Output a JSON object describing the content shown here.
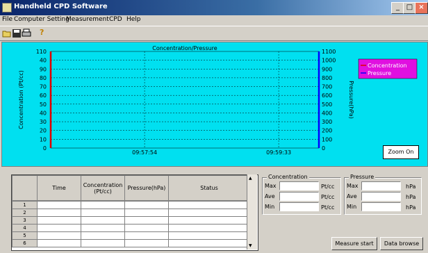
{
  "window": {
    "title": "Handheld CPD Software"
  },
  "menu": [
    "File",
    "Computer Setting",
    "Measurement",
    "CPD",
    "Help"
  ],
  "toolbar": {
    "icons": [
      "open-icon",
      "save-icon",
      "print-icon",
      "help-icon"
    ],
    "help_glyph": "?"
  },
  "chart": {
    "title": "Concentration/Pressure",
    "left_axis_label": "Concentration (Pt/cc)",
    "right_axis_label": "Pressure(hPa)",
    "left_ticks": [
      "110",
      "40",
      "90",
      "80",
      "70",
      "60",
      "50",
      "40",
      "30",
      "20",
      "10",
      "0"
    ],
    "right_ticks": [
      "1100",
      "1000",
      "900",
      "800",
      "700",
      "600",
      "500",
      "400",
      "300",
      "200",
      "100",
      "0"
    ],
    "x_ticks": [
      "09:57:54",
      "09:59:33"
    ],
    "legend": [
      "Concentration",
      "Pressure"
    ],
    "zoom_label": "Zoom On",
    "background": "#00e0f0",
    "concentration_color": "#e00000",
    "pressure_color": "#0000ff",
    "legend_bg": "#e010e0"
  },
  "chart_data": {
    "type": "line",
    "title": "Concentration/Pressure",
    "x": [],
    "series": [
      {
        "name": "Concentration",
        "values": []
      },
      {
        "name": "Pressure",
        "values": []
      }
    ],
    "ylim": [
      0,
      110
    ],
    "y2lim": [
      0,
      1100
    ],
    "grid": true,
    "legend_position": "right"
  },
  "table": {
    "columns": [
      "Time",
      "Concentration (Pt/cc)",
      "Pressure(hPa)",
      "Status"
    ],
    "row_numbers": [
      "1",
      "2",
      "3",
      "4",
      "5",
      "6"
    ]
  },
  "concentration_box": {
    "title": "Concentration",
    "rows": [
      {
        "label": "Max",
        "value": "",
        "unit": "Pt/cc"
      },
      {
        "label": "Ave",
        "value": "",
        "unit": "Pt/cc"
      },
      {
        "label": "Min",
        "value": "",
        "unit": "Pt/cc"
      }
    ]
  },
  "pressure_box": {
    "title": "Pressure",
    "rows": [
      {
        "label": "Max",
        "value": "",
        "unit": "hPa"
      },
      {
        "label": "Ave",
        "value": "",
        "unit": "hPa"
      },
      {
        "label": "Min",
        "value": "",
        "unit": "hPa"
      }
    ]
  },
  "buttons": {
    "measure_start": "Measure start",
    "data_browse": "Data browse"
  }
}
